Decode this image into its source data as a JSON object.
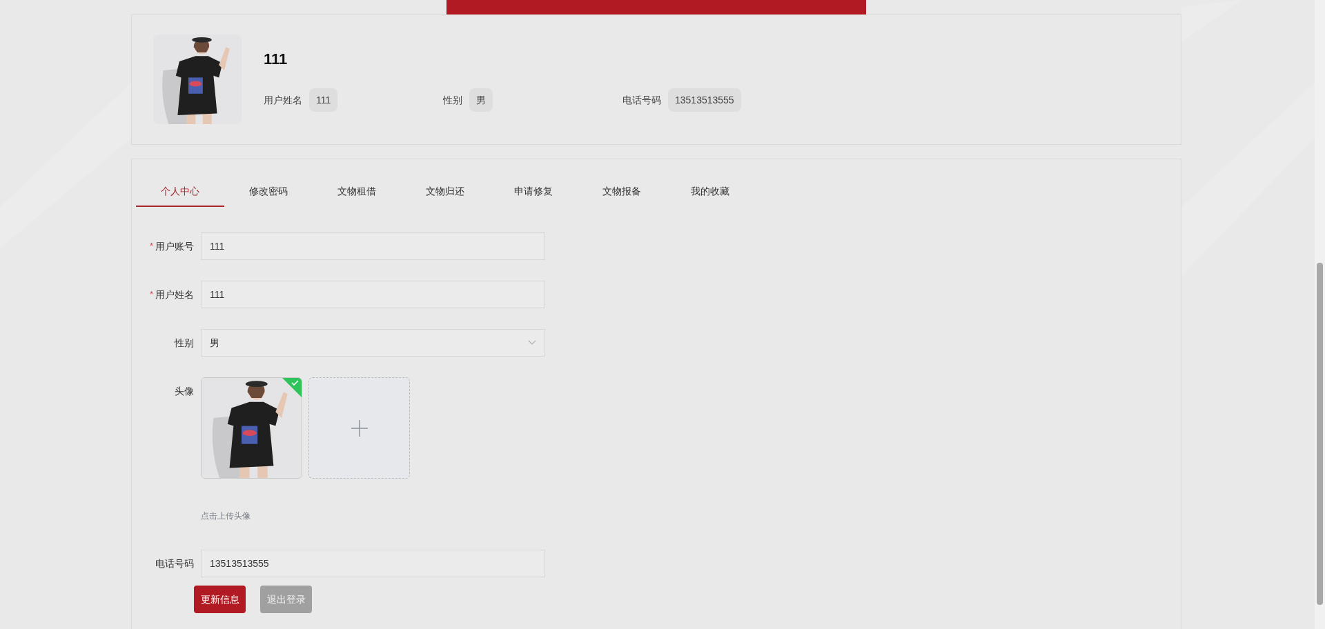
{
  "profile": {
    "kind": "picture",
    "name": "111",
    "info": [
      {
        "label": "用户姓名",
        "value": "111"
      },
      {
        "label": "性别",
        "value": "男"
      },
      {
        "label": "电话号码",
        "value": "13513513555"
      }
    ]
  },
  "tabs": [
    {
      "label": "个人中心",
      "selected": true
    },
    {
      "label": "修改密码",
      "selected": false
    },
    {
      "label": "文物租借",
      "selected": false
    },
    {
      "label": "文物归还",
      "selected": false
    },
    {
      "label": "申请修复",
      "selected": false
    },
    {
      "label": "文物报备",
      "selected": false
    },
    {
      "label": "我的收藏",
      "selected": false
    }
  ],
  "form": {
    "fields": [
      {
        "kind": "input",
        "label": "用户账号",
        "required_mark": "*",
        "value": "111"
      },
      {
        "kind": "input",
        "label": "用户姓名",
        "required_mark": "*",
        "value": "111"
      },
      {
        "kind": "select",
        "label": "性别",
        "value": "男"
      },
      {
        "kind": "upload",
        "label": "头像",
        "uploaded": true,
        "hint": "点击上传头像"
      },
      {
        "kind": "input",
        "label": "电话号码",
        "value": "13513513555"
      }
    ],
    "buttons": [
      {
        "kind": "primary",
        "label": "更新信息"
      },
      {
        "kind": "secondary",
        "label": "退出登录"
      }
    ]
  }
}
